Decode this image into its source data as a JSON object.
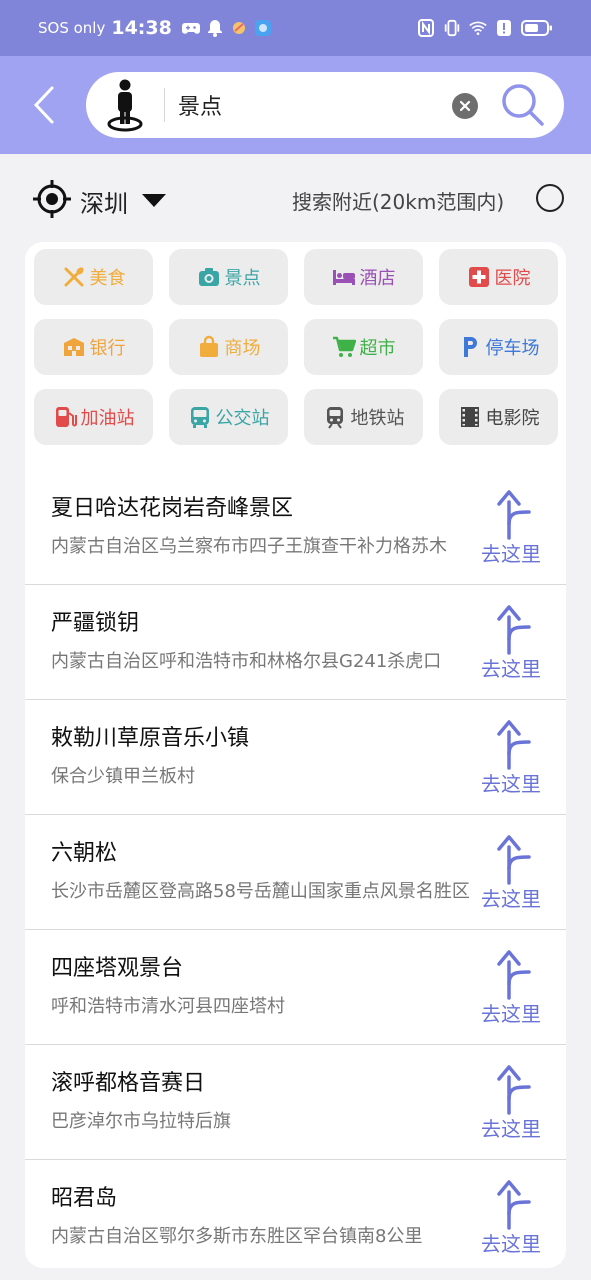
{
  "status_bar": {
    "carrier": "SOS only",
    "time": "14:38",
    "icons_left": [
      "game-controller-icon",
      "bell-icon",
      "app-icon",
      "app-icon"
    ],
    "icons_right": [
      "nfc-icon",
      "vibrate-icon",
      "wifi-icon",
      "alert-icon",
      "battery-icon"
    ]
  },
  "header": {
    "search_value": "景点",
    "icons": [
      "back-arrow-icon",
      "person-icon",
      "clear-icon",
      "search-icon"
    ]
  },
  "location": {
    "city": "深圳",
    "nearby_label": "搜索附近(20km范围内)"
  },
  "categories": [
    {
      "label": "美食",
      "icon": "utensils-icon",
      "color": "#f0ad3c"
    },
    {
      "label": "景点",
      "icon": "camera-icon",
      "color": "#3aa5a5"
    },
    {
      "label": "酒店",
      "icon": "bed-icon",
      "color": "#9b50b5"
    },
    {
      "label": "医院",
      "icon": "medical-cross-icon",
      "color": "#e24b4b"
    },
    {
      "label": "银行",
      "icon": "bank-icon",
      "color": "#f0a43c"
    },
    {
      "label": "商场",
      "icon": "shopping-bag-icon",
      "color": "#f0ad3c"
    },
    {
      "label": "超市",
      "icon": "cart-icon",
      "color": "#3fb247"
    },
    {
      "label": "停车场",
      "icon": "parking-icon",
      "color": "#3e78d8"
    },
    {
      "label": "加油站",
      "icon": "gas-pump-icon",
      "color": "#e24b4b"
    },
    {
      "label": "公交站",
      "icon": "bus-icon",
      "color": "#3aa5a5"
    },
    {
      "label": "地铁站",
      "icon": "subway-icon",
      "color": "#555555"
    },
    {
      "label": "电影院",
      "icon": "film-icon",
      "color": "#444444"
    }
  ],
  "go_label": "去这里",
  "results": [
    {
      "title": "夏日哈达花岗岩奇峰景区",
      "address": "内蒙古自治区乌兰察布市四子王旗查干补力格苏木"
    },
    {
      "title": "严疆锁钥",
      "address": "内蒙古自治区呼和浩特市和林格尔县G241杀虎口"
    },
    {
      "title": "敕勒川草原音乐小镇",
      "address": "保合少镇甲兰板村"
    },
    {
      "title": "六朝松",
      "address": "长沙市岳麓区登高路58号岳麓山国家重点风景名胜区"
    },
    {
      "title": "四座塔观景台",
      "address": "呼和浩特市清水河县四座塔村"
    },
    {
      "title": "滚呼都格音赛日",
      "address": "巴彦淖尔市乌拉特后旗"
    },
    {
      "title": "昭君岛",
      "address": "内蒙古自治区鄂尔多斯市东胜区罕台镇南8公里"
    }
  ],
  "colors": {
    "status_bar": "#8185d9",
    "header": "#a0a3f2",
    "accent": "#6a74d8",
    "background": "#f2f2f4"
  }
}
